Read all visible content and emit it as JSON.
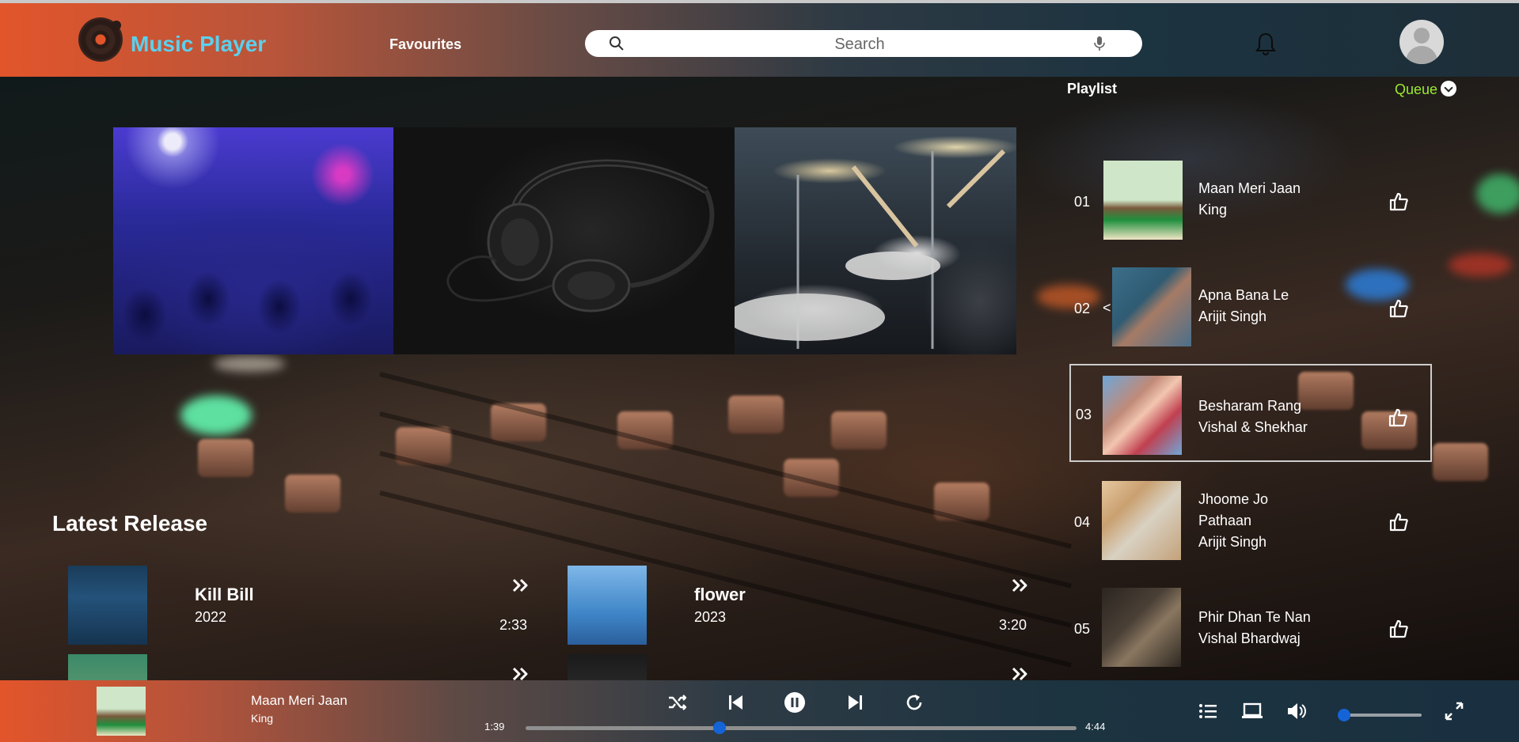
{
  "header": {
    "app_title": "Music Player",
    "nav_favourites": "Favourites",
    "search_placeholder": "Search",
    "icons": [
      "vinyl-logo-icon",
      "search-icon",
      "mic-icon",
      "bell-icon",
      "user-avatar"
    ]
  },
  "playlist": {
    "title": "Playlist",
    "queue_label": "Queue",
    "items": [
      {
        "num": "01",
        "line1": "Maan Meri Jaan",
        "line2": "King",
        "line3": ""
      },
      {
        "num": "02",
        "line1": "Apna Bana Le",
        "line2": "Arijit Singh",
        "line3": ""
      },
      {
        "num": "03",
        "line1": "Besharam Rang",
        "line2": "Vishal & Shekhar",
        "line3": ""
      },
      {
        "num": "04",
        "line1": "Jhoome Jo",
        "line2": "Pathaan",
        "line3": "Arijit Singh"
      },
      {
        "num": "05",
        "line1": "Phir Dhan Te Nan",
        "line2": "Vishal Bhardwaj",
        "line3": ""
      }
    ],
    "prev_arrow": "<"
  },
  "latest": {
    "title": "Latest Release",
    "items": [
      {
        "name": "Kill Bill",
        "year": "2022",
        "duration": "2:33"
      },
      {
        "name": "flower",
        "year": "2023",
        "duration": "3:20"
      }
    ]
  },
  "player": {
    "title": "Maan Meri Jaan",
    "artist": "King",
    "elapsed": "1:39",
    "total": "4:44",
    "progress_fraction": 0.35,
    "volume_fraction": 0.0
  },
  "colors": {
    "accent_blue": "#1464d8",
    "title_cyan": "#5bd0ee",
    "queue_green": "#9bea2e",
    "header_orange": "#e2552b"
  }
}
